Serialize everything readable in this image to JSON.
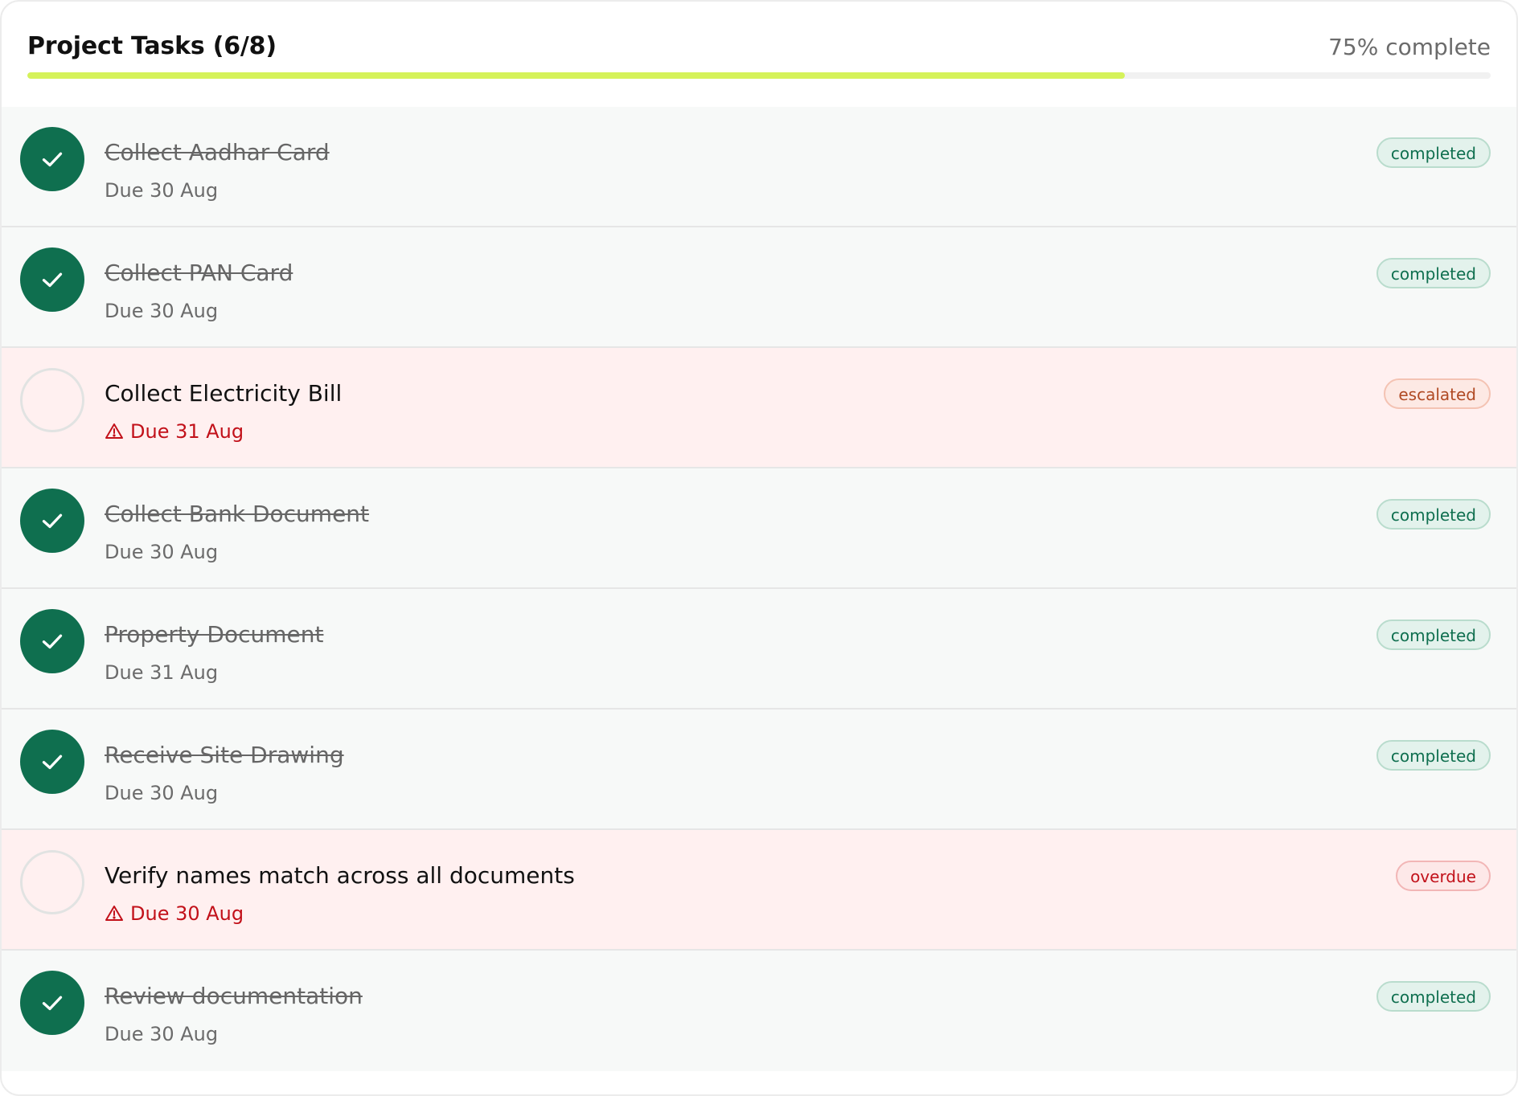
{
  "header": {
    "title": "Project Tasks (6/8)",
    "progress_text": "75% complete",
    "progress_value": 75
  },
  "colors": {
    "accent_green": "#0f6f4f",
    "progress_fill": "#d5f25a",
    "alert_red": "#c2111a"
  },
  "tasks": [
    {
      "title": "Collect Aadhar Card",
      "due": "Due 30 Aug",
      "status": "completed",
      "done": true,
      "icon": "check-icon"
    },
    {
      "title": "Collect PAN Card",
      "due": "Due 30 Aug",
      "status": "completed",
      "done": true,
      "icon": "check-icon"
    },
    {
      "title": "Collect Electricity Bill",
      "due": "Due 31 Aug",
      "status": "escalated",
      "done": false,
      "icon": "warning-icon"
    },
    {
      "title": "Collect Bank Document",
      "due": "Due 30 Aug",
      "status": "completed",
      "done": true,
      "icon": "check-icon"
    },
    {
      "title": "Property Document",
      "due": "Due 31 Aug",
      "status": "completed",
      "done": true,
      "icon": "check-icon"
    },
    {
      "title": "Receive Site Drawing",
      "due": "Due 30 Aug",
      "status": "completed",
      "done": true,
      "icon": "check-icon"
    },
    {
      "title": "Verify names match across all documents",
      "due": "Due 30 Aug",
      "status": "overdue",
      "done": false,
      "icon": "warning-icon"
    },
    {
      "title": "Review documentation",
      "due": "Due 30 Aug",
      "status": "completed",
      "done": true,
      "icon": "check-icon"
    }
  ]
}
